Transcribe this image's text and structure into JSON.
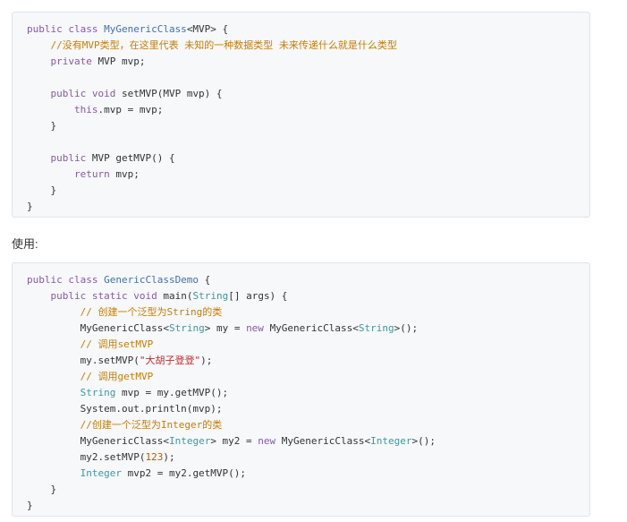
{
  "code_block_1": {
    "lines": [
      [
        {
          "t": "public class ",
          "c": "kw"
        },
        {
          "t": "MyGenericClass",
          "c": "cls"
        },
        {
          "t": "<MVP> {",
          "c": "plain"
        }
      ],
      [
        {
          "t": "    //没有MVP类型，在这里代表 未知的一种数据类型 未来传递什么就是什么类型",
          "c": "cmt"
        }
      ],
      [
        {
          "t": "    private ",
          "c": "kw"
        },
        {
          "t": "MVP mvp;",
          "c": "plain"
        }
      ],
      [],
      [
        {
          "t": "    public void ",
          "c": "kw"
        },
        {
          "t": "setMVP(MVP mvp) {",
          "c": "plain"
        }
      ],
      [
        {
          "t": "        this",
          "c": "kw"
        },
        {
          "t": ".mvp = mvp;",
          "c": "plain"
        }
      ],
      [
        {
          "t": "    }",
          "c": "plain"
        }
      ],
      [],
      [
        {
          "t": "    public ",
          "c": "kw"
        },
        {
          "t": "MVP getMVP() {",
          "c": "plain"
        }
      ],
      [
        {
          "t": "        return ",
          "c": "kw"
        },
        {
          "t": "mvp;",
          "c": "plain"
        }
      ],
      [
        {
          "t": "    }",
          "c": "plain"
        }
      ],
      [
        {
          "t": "}",
          "c": "plain"
        }
      ]
    ]
  },
  "section_label": "使用:",
  "code_block_2": {
    "lines": [
      [
        {
          "t": "public class ",
          "c": "kw"
        },
        {
          "t": "GenericClassDemo",
          "c": "cls"
        },
        {
          "t": " {",
          "c": "plain"
        }
      ],
      [
        {
          "t": "    public static void ",
          "c": "kw"
        },
        {
          "t": "main(",
          "c": "plain"
        },
        {
          "t": "String",
          "c": "type"
        },
        {
          "t": "[] args) {",
          "c": "plain"
        }
      ],
      [
        {
          "t": "         // 创建一个泛型为String的类",
          "c": "cmt"
        }
      ],
      [
        {
          "t": "         MyGenericClass<",
          "c": "plain"
        },
        {
          "t": "String",
          "c": "type"
        },
        {
          "t": "> my = ",
          "c": "plain"
        },
        {
          "t": "new ",
          "c": "kw"
        },
        {
          "t": "MyGenericClass<",
          "c": "plain"
        },
        {
          "t": "String",
          "c": "type"
        },
        {
          "t": ">();",
          "c": "plain"
        }
      ],
      [
        {
          "t": "         // 调用setMVP",
          "c": "cmt"
        }
      ],
      [
        {
          "t": "         my.setMVP(",
          "c": "plain"
        },
        {
          "t": "\"大胡子登登\"",
          "c": "str"
        },
        {
          "t": ");",
          "c": "plain"
        }
      ],
      [
        {
          "t": "         // 调用getMVP",
          "c": "cmt"
        }
      ],
      [
        {
          "t": "         String",
          "c": "type"
        },
        {
          "t": " mvp = my.getMVP();",
          "c": "plain"
        }
      ],
      [
        {
          "t": "         System.out.println(mvp);",
          "c": "plain"
        }
      ],
      [
        {
          "t": "         //创建一个泛型为Integer的类",
          "c": "cmt"
        }
      ],
      [
        {
          "t": "         MyGenericClass<",
          "c": "plain"
        },
        {
          "t": "Integer",
          "c": "type"
        },
        {
          "t": "> my2 = ",
          "c": "plain"
        },
        {
          "t": "new ",
          "c": "kw"
        },
        {
          "t": "MyGenericClass<",
          "c": "plain"
        },
        {
          "t": "Integer",
          "c": "type"
        },
        {
          "t": ">();",
          "c": "plain"
        }
      ],
      [
        {
          "t": "         my2.setMVP(",
          "c": "plain"
        },
        {
          "t": "123",
          "c": "num"
        },
        {
          "t": ");",
          "c": "plain"
        }
      ],
      [
        {
          "t": "         Integer",
          "c": "type"
        },
        {
          "t": " mvp2 = my2.getMVP();",
          "c": "plain"
        }
      ],
      [
        {
          "t": "    }",
          "c": "plain"
        }
      ],
      [
        {
          "t": "}",
          "c": "plain"
        }
      ]
    ]
  },
  "colors": {
    "keyword": "#8959a8",
    "type": "#3e999f",
    "class_name": "#4271ae",
    "comment": "#c97c00",
    "string": "#c82829",
    "number": "#b35c00",
    "plain": "#333333",
    "code_background": "#f6f8fa"
  }
}
